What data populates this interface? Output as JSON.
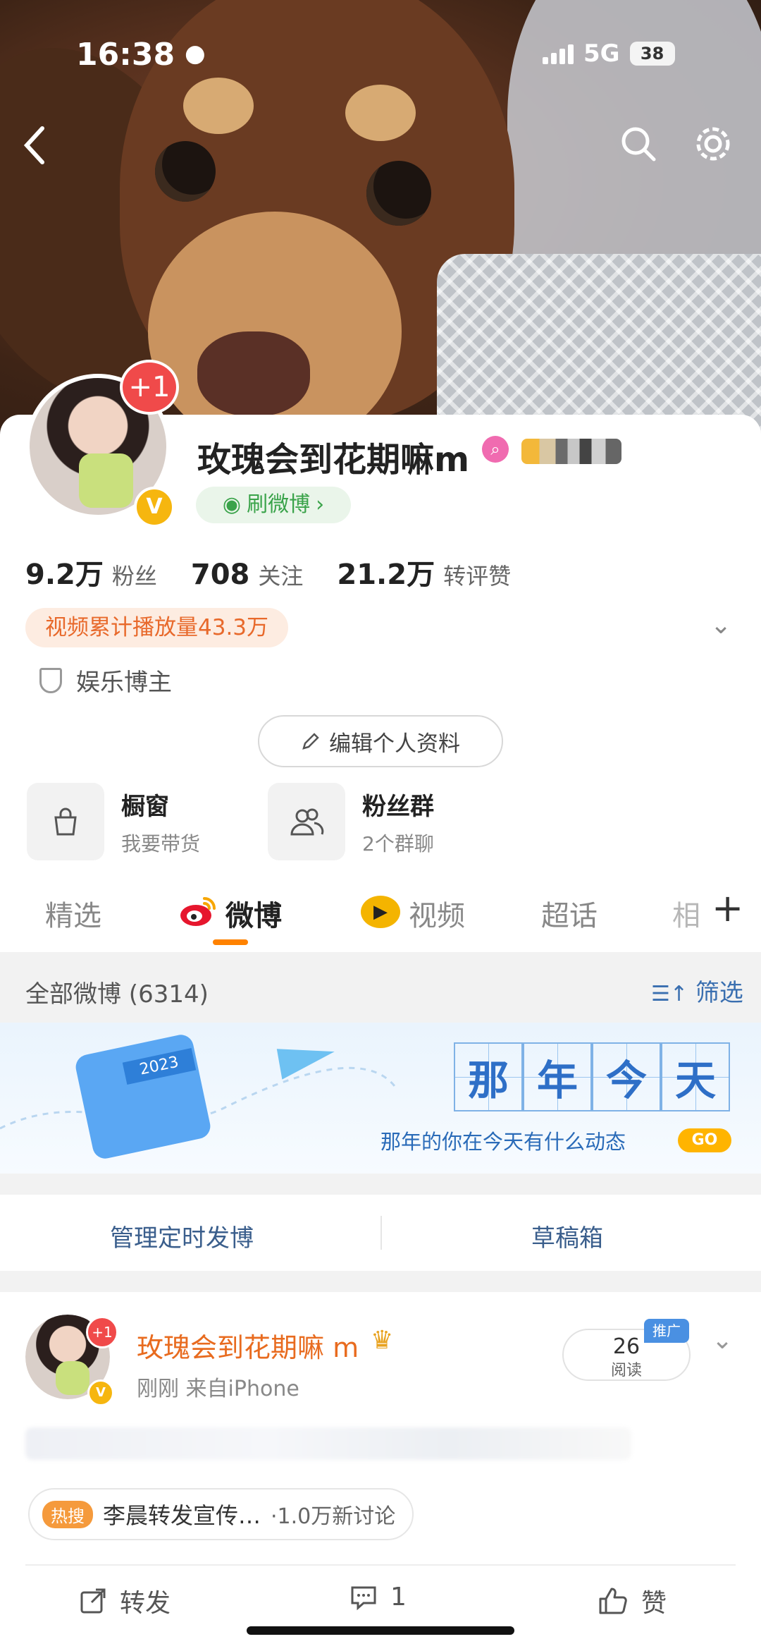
{
  "status_bar": {
    "time": "16:38",
    "network": "5G",
    "battery": "38"
  },
  "profile": {
    "name": "玫瑰会到花期嘛m",
    "avatar_badge": "+1",
    "brush_label": "刷微博",
    "stats": [
      {
        "num": "9.2万",
        "label": "粉丝"
      },
      {
        "num": "708",
        "label": "关注"
      },
      {
        "num": "21.2万",
        "label": "转评赞"
      }
    ],
    "play_count": "视频累计播放量43.3万",
    "tag": "娱乐博主",
    "edit_label": "编辑个人资料",
    "tiles": [
      {
        "title": "橱窗",
        "sub": "我要带货"
      },
      {
        "title": "粉丝群",
        "sub": "2个群聊"
      }
    ]
  },
  "tabs": {
    "t1": "精选",
    "t2": "微博",
    "t3": "视频",
    "t4": "超话",
    "t5": "相"
  },
  "feed_header": {
    "all": "全部微博 (6314)",
    "filter": "筛选"
  },
  "banner": {
    "calendar_year": "2023",
    "chars": [
      "那",
      "年",
      "今",
      "天"
    ],
    "tagline": "那年的你在今天有什么动态",
    "go": "GO"
  },
  "manage": {
    "scheduled": "管理定时发博",
    "drafts": "草稿箱"
  },
  "post": {
    "name": "玫瑰会到花期嘛 m",
    "badge": "+1",
    "meta": "刚刚  来自iPhone",
    "reads_num": "26",
    "reads_label": "阅读",
    "promo": "推广",
    "hot_badge": "热搜",
    "hot_text": "李晨转发宣传…",
    "hot_count": "·1.0万新讨论",
    "actions": {
      "repost": "转发",
      "comment": "1",
      "like": "赞"
    }
  },
  "icons": [
    "back-icon",
    "search-icon",
    "gear-icon",
    "signal-icon",
    "battery-icon",
    "weibo-logo-icon",
    "video-icon",
    "pencil-icon",
    "bag-icon",
    "group-icon",
    "shield-icon",
    "filter-icon",
    "repost-icon",
    "comment-icon",
    "like-icon",
    "chevron-down-icon"
  ],
  "colors": {
    "accent": "#ff8200",
    "link_blue": "#3a6fb0",
    "badge_red": "#f04a4a",
    "verified_gold": "#f6b60f",
    "play_chip_text": "#e8692b"
  }
}
